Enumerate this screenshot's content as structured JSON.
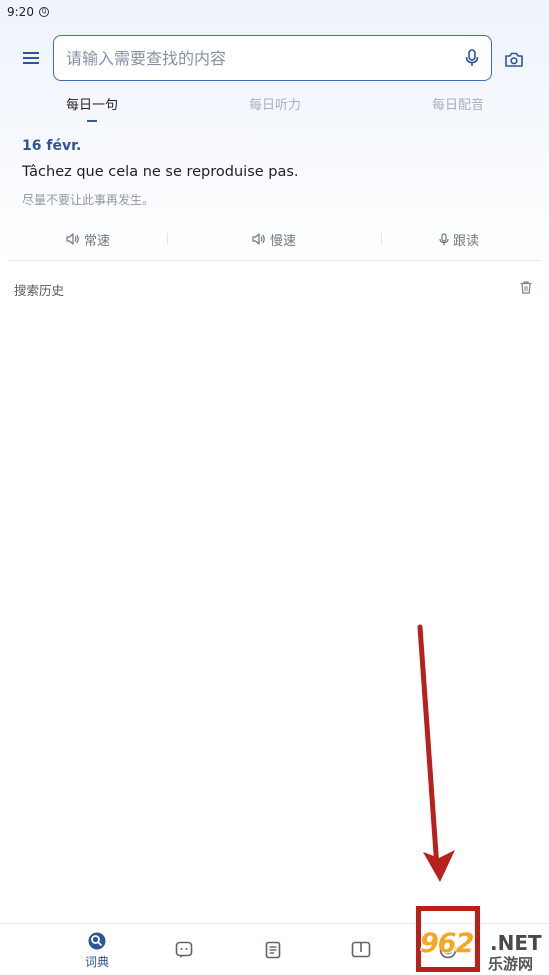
{
  "status_bar": {
    "time": "9:20",
    "notification_icon": "notification-icon"
  },
  "search": {
    "placeholder": "请输入需要查找的内容",
    "value": ""
  },
  "tabs": [
    {
      "label": "每日一句",
      "active": true
    },
    {
      "label": "每日听力",
      "active": false
    },
    {
      "label": "每日配音",
      "active": false
    }
  ],
  "daily_card": {
    "date": "16 févr.",
    "sentence": "Tâchez que cela ne se reproduise pas.",
    "translation": "尽量不要让此事再发生。"
  },
  "audio_controls": [
    {
      "label": "常速",
      "icon": "speaker-icon"
    },
    {
      "label": "慢速",
      "icon": "speaker-icon"
    },
    {
      "label": "跟读",
      "icon": "mic-icon"
    }
  ],
  "history": {
    "title": "搜索历史",
    "clear_icon": "trash-icon"
  },
  "bottom_nav": [
    {
      "label": "词典",
      "icon": "dictionary-icon",
      "active": true
    },
    {
      "label": "",
      "icon": "chat-icon",
      "active": false
    },
    {
      "label": "",
      "icon": "notes-icon",
      "active": false
    },
    {
      "label": "",
      "icon": "book-icon",
      "active": false
    },
    {
      "label": "",
      "icon": "profile-icon",
      "active": false
    }
  ],
  "watermark": {
    "number": "962",
    "suffix": ".NET",
    "text": "乐游网"
  },
  "colors": {
    "accent": "#2f5597",
    "search_border": "#3d6fb8",
    "annotation_red": "#b8201c",
    "watermark_orange": "#f5a623"
  }
}
